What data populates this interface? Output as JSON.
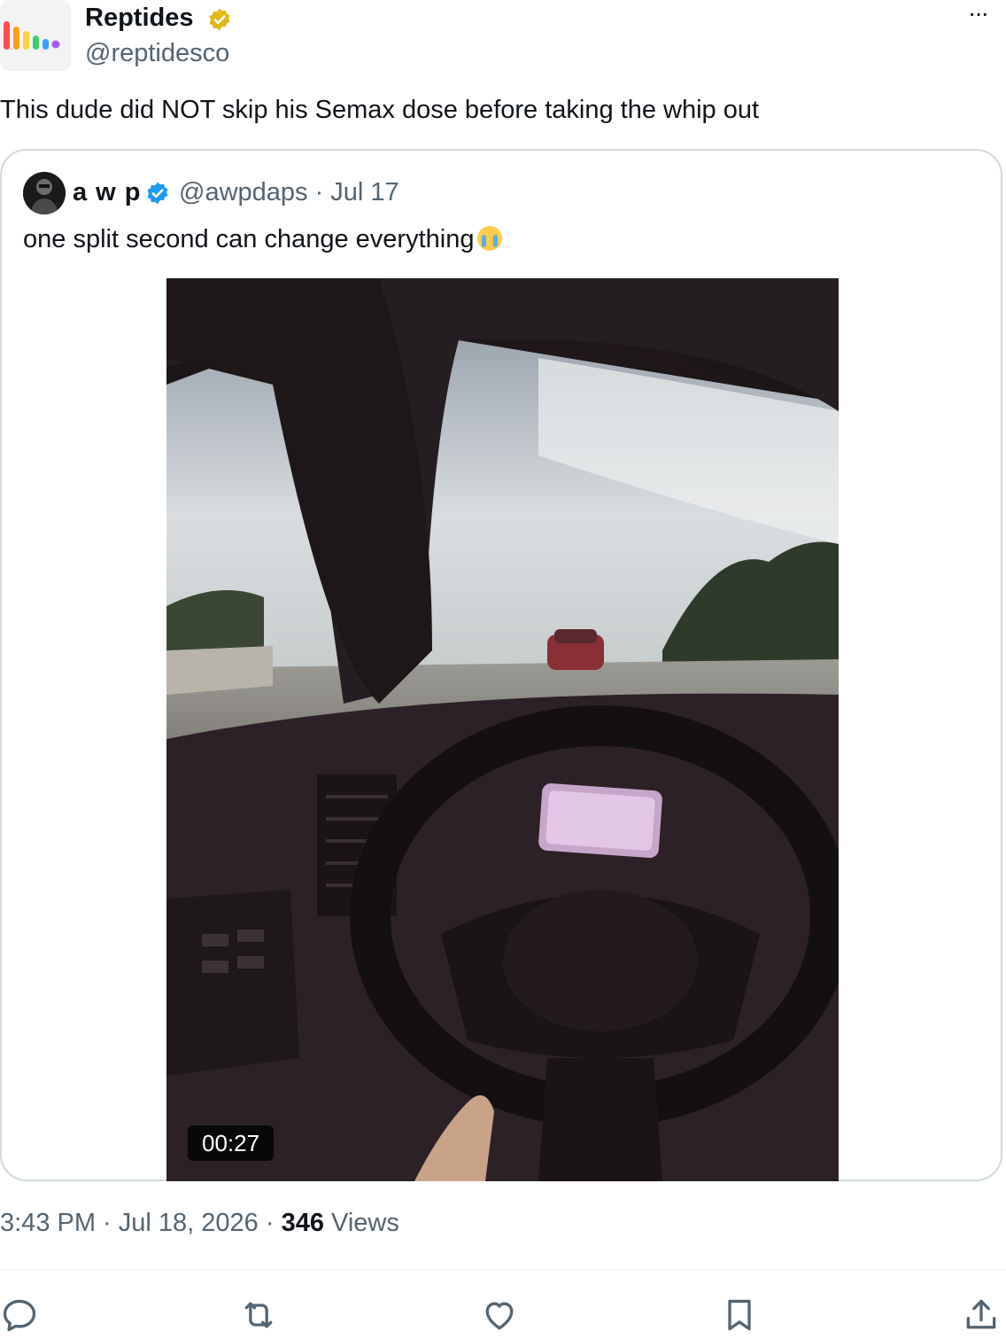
{
  "author": {
    "display_name": "Reptides",
    "handle": "@reptidesco",
    "verified_badge": "gold-check-icon",
    "logo_colors": [
      "#ff4d4d",
      "#ff9f1a",
      "#ffd23f",
      "#3ecf6b",
      "#3b9cff",
      "#a35bff"
    ]
  },
  "more_label": "···",
  "tweet_text": "This dude did NOT skip his Semax dose before taking the whip out",
  "quote": {
    "display_name": "a w p",
    "verified_badge": "blue-check-icon",
    "meta": "@awpdaps · Jul 17",
    "text": "one split second can change everything",
    "emoji": "loudly-crying-face",
    "video_duration": "00:27"
  },
  "footer": {
    "timestamp": "3:43 PM · Jul 18, 2026 · ",
    "views_count": "346",
    "views_label": " Views"
  },
  "actions": [
    "reply-icon",
    "retweet-icon",
    "like-icon",
    "bookmark-icon",
    "share-icon"
  ],
  "colors": {
    "text": "#0f1419",
    "secondary": "#536471",
    "border": "#cfd9de",
    "verified_blue": "#1d9bf0",
    "verified_gold": "#e2b719"
  }
}
